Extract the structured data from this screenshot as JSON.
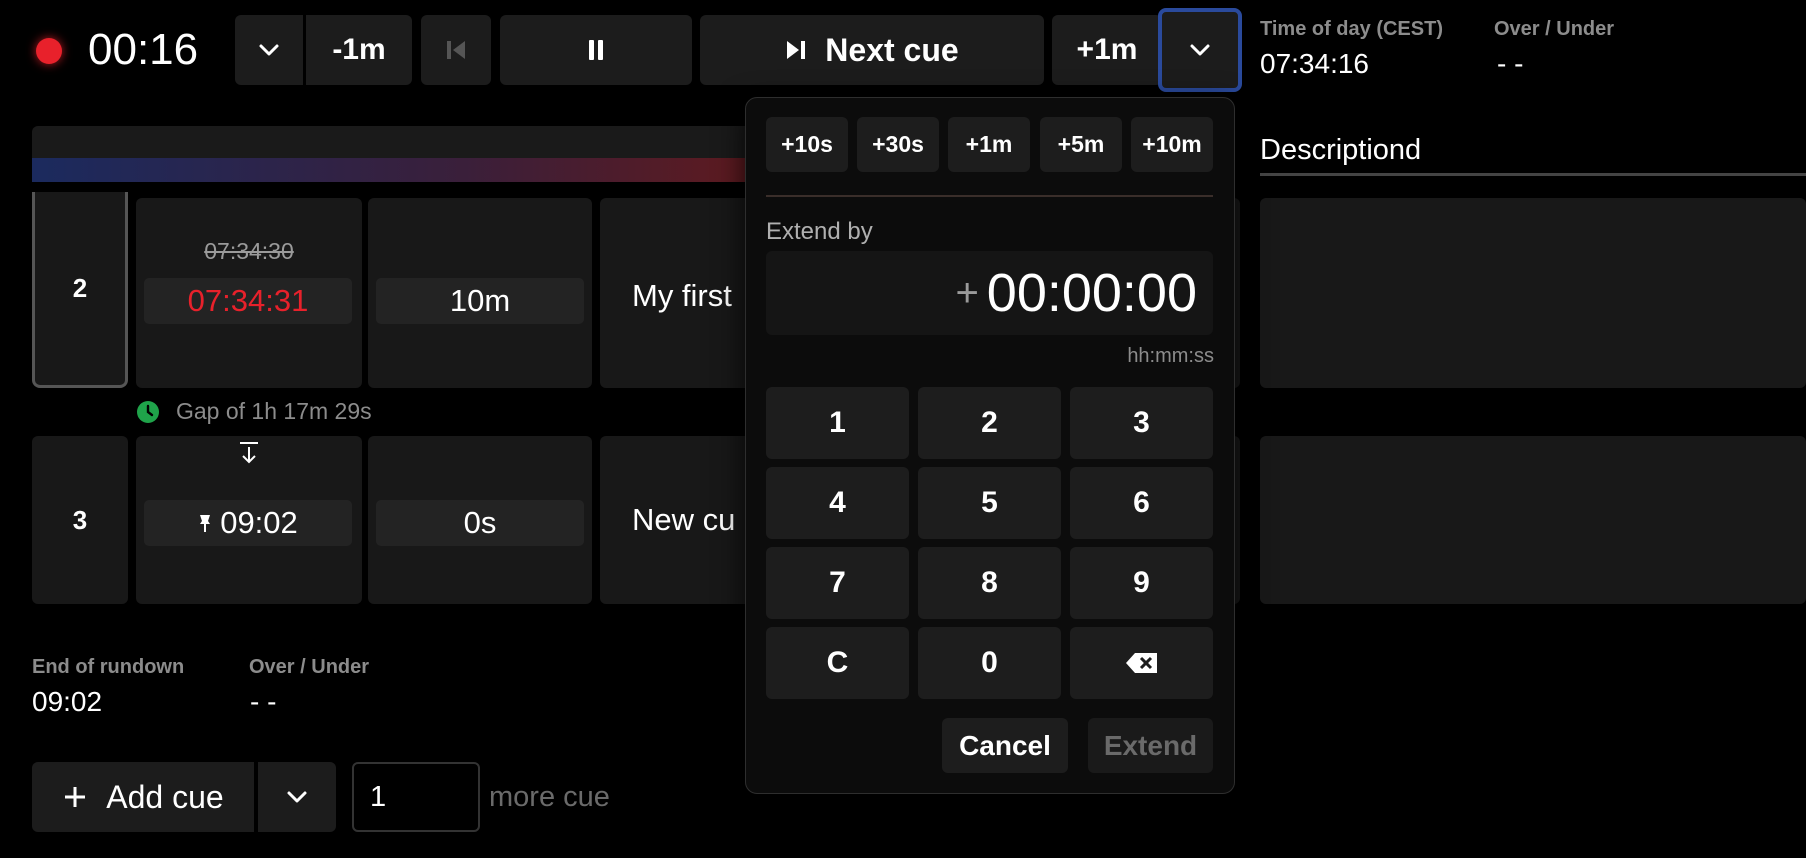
{
  "header": {
    "elapsed": "00:16",
    "minus_label": "-1m",
    "next_cue_label": "Next cue",
    "plus_label": "+1m",
    "time_of_day_label": "Time of day (CEST)",
    "time_of_day_value": "07:34:16",
    "over_under_label": "Over / Under",
    "over_under_value": "- -"
  },
  "columns": {
    "description_label": "Descriptiond"
  },
  "rows": [
    {
      "index": "2",
      "planned_time": "07:34:30",
      "actual_time": "07:34:31",
      "duration": "10m",
      "title": "My first"
    },
    {
      "index": "3",
      "time": "09:02",
      "duration": "0s",
      "title": "New cu"
    }
  ],
  "gap_text": "Gap of 1h 17m 29s",
  "footer": {
    "end_of_rundown_label": "End of rundown",
    "end_of_rundown_value": "09:02",
    "over_under_label": "Over / Under",
    "over_under_value": "- -"
  },
  "add_cue": {
    "label": "Add cue",
    "count_value": "1",
    "suffix": "more cue"
  },
  "popover": {
    "quick_adds": [
      "+10s",
      "+30s",
      "+1m",
      "+5m",
      "+10m"
    ],
    "extend_by_label": "Extend by",
    "plus_sign": "+",
    "extend_value": "00:00:00",
    "format_hint": "hh:mm:ss",
    "keys": [
      "1",
      "2",
      "3",
      "4",
      "5",
      "6",
      "7",
      "8",
      "9",
      "C",
      "0"
    ],
    "cancel_label": "Cancel",
    "extend_label": "Extend"
  },
  "colors": {
    "record_dot": "#e8212b",
    "late_time": "#e8212b",
    "gap_icon": "#1fa34a",
    "focus_outline": "#2a4a9c"
  },
  "icons": {
    "backspace": "backspace-icon",
    "pause": "pause-icon",
    "skip_next": "skip-next-icon",
    "skip_previous": "skip-previous-icon",
    "chevron": "chevron-down-icon",
    "clock": "clock-icon",
    "pin": "pin-icon",
    "plus": "plus-icon"
  }
}
